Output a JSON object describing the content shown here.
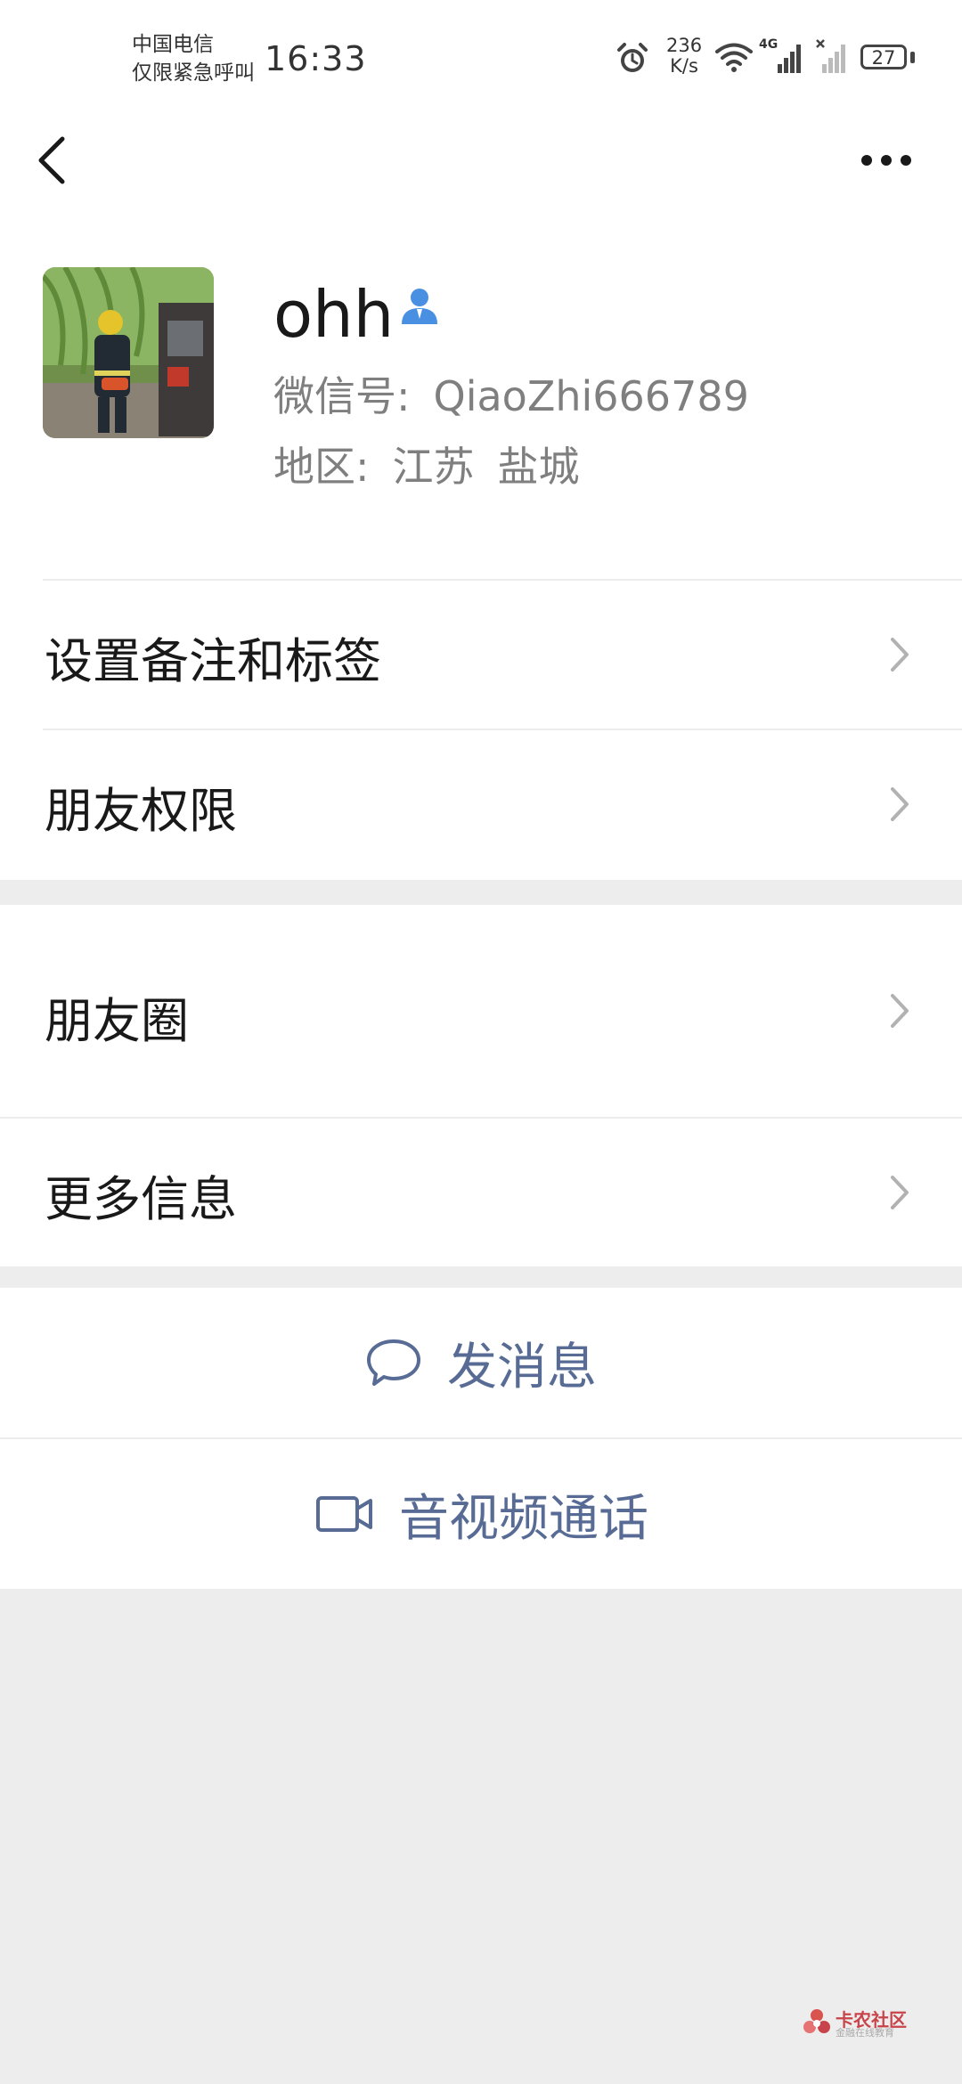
{
  "status_bar": {
    "carrier_line1": "中国电信",
    "carrier_line2": "仅限紧急呼叫",
    "time": "16:33",
    "speed_value": "236",
    "speed_unit": "K/s",
    "network": "4G",
    "battery": "27"
  },
  "profile": {
    "nickname": "ohh",
    "wechat_id_label": "微信号:",
    "wechat_id": "QiaoZhi666789",
    "region_label": "地区:",
    "province": "江苏",
    "city": "盐城"
  },
  "menu": {
    "remark_tags": "设置备注和标签",
    "friend_permissions": "朋友权限",
    "moments": "朋友圈",
    "more_info": "更多信息"
  },
  "actions": {
    "send_message": "发消息",
    "video_call": "音视频通话"
  },
  "watermark": {
    "title": "卡农社区",
    "subtitle": "金融在线教育"
  },
  "colors": {
    "link_blue": "#576b95",
    "badge_blue": "#4a90e2"
  }
}
